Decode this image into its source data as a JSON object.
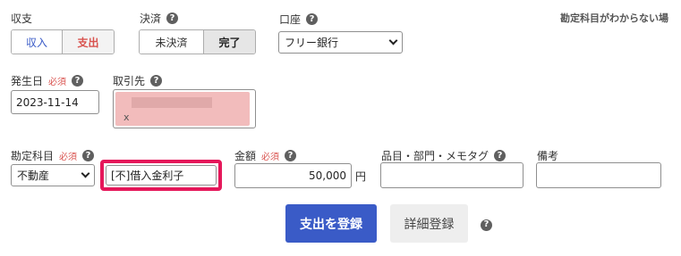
{
  "income_expense": {
    "label": "収支",
    "options": [
      "収入",
      "支出"
    ],
    "selected": "支出"
  },
  "settlement": {
    "label": "決済",
    "options": [
      "未決済",
      "完了"
    ],
    "selected": "完了"
  },
  "account": {
    "label": "口座",
    "value": "フリー銀行"
  },
  "hint": "勘定科目がわからない場",
  "date": {
    "label": "発生日",
    "required": "必須",
    "value": "2023-11-14"
  },
  "partner": {
    "label": "取引先",
    "tag_remove": "x"
  },
  "category": {
    "label": "勘定科目",
    "required": "必須",
    "select_value": "不動産",
    "input_value": "[不]借入金利子"
  },
  "amount": {
    "label": "金額",
    "required": "必須",
    "value": "50,000",
    "unit": "円"
  },
  "item": {
    "label": "品目・部門・メモタグ"
  },
  "note": {
    "label": "備考"
  },
  "actions": {
    "register": "支出を登録",
    "detail": "詳細登録"
  },
  "colors": {
    "primary": "#3a5bc7",
    "required": "#d9534f",
    "highlight": "#e5175a",
    "partner_tag": "#f2bcbc"
  },
  "icons": {
    "help": "question-circle-icon",
    "dropdown": "chevron-down-icon"
  }
}
